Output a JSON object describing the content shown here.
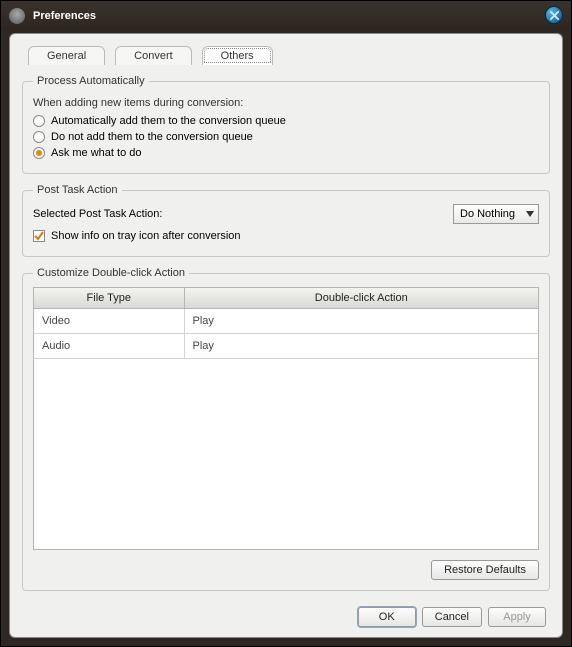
{
  "window": {
    "title": "Preferences"
  },
  "tabs": {
    "general": "General",
    "convert": "Convert",
    "others": "Others"
  },
  "process": {
    "legend": "Process Automatically",
    "desc": "When adding new items during conversion:",
    "opt_auto_add": "Automatically add them to the conversion queue",
    "opt_do_not_add": "Do not add them to the conversion queue",
    "opt_ask": "Ask me what to do"
  },
  "posttask": {
    "legend": "Post Task Action",
    "label": "Selected Post Task Action:",
    "selected": "Do Nothing",
    "show_info": "Show info on tray icon after conversion"
  },
  "customize": {
    "legend": "Customize Double-click Action",
    "col_filetype": "File Type",
    "col_action": "Double-click Action",
    "rows": [
      {
        "type": "Video",
        "action": "Play"
      },
      {
        "type": "Audio",
        "action": "Play"
      }
    ]
  },
  "buttons": {
    "restore": "Restore Defaults",
    "ok": "OK",
    "cancel": "Cancel",
    "apply": "Apply"
  }
}
